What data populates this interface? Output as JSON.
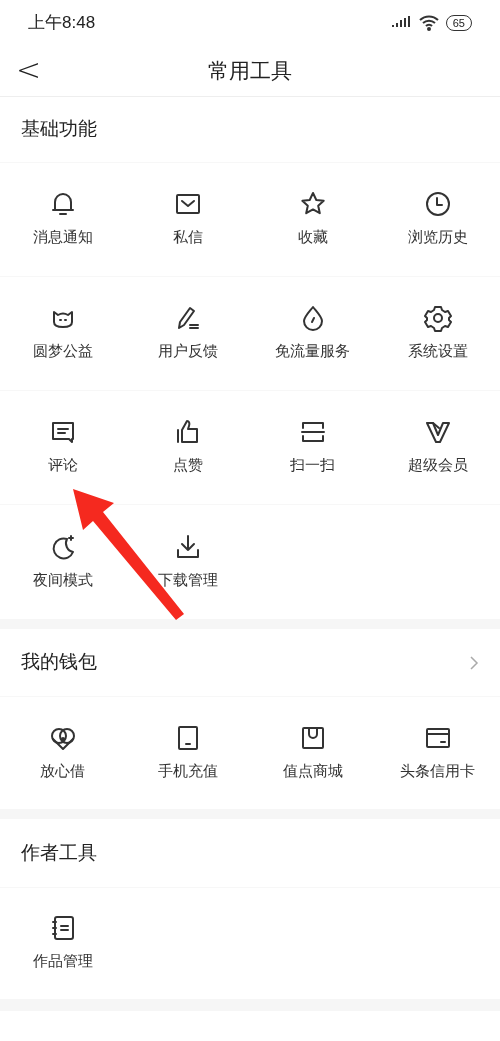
{
  "status_bar": {
    "time": "上午8:48",
    "battery": "65"
  },
  "nav": {
    "back": "<",
    "title": "常用工具"
  },
  "sections": [
    {
      "title": "基础功能",
      "has_more": false,
      "items": [
        {
          "label": "消息通知"
        },
        {
          "label": "私信"
        },
        {
          "label": "收藏"
        },
        {
          "label": "浏览历史"
        },
        {
          "label": "圆梦公益"
        },
        {
          "label": "用户反馈"
        },
        {
          "label": "免流量服务"
        },
        {
          "label": "系统设置"
        },
        {
          "label": "评论"
        },
        {
          "label": "点赞"
        },
        {
          "label": "扫一扫"
        },
        {
          "label": "超级会员"
        },
        {
          "label": "夜间模式"
        },
        {
          "label": "下载管理"
        }
      ]
    },
    {
      "title": "我的钱包",
      "has_more": true,
      "items": [
        {
          "label": "放心借"
        },
        {
          "label": "手机充值"
        },
        {
          "label": "值点商城"
        },
        {
          "label": "头条信用卡"
        }
      ]
    },
    {
      "title": "作者工具",
      "has_more": false,
      "items": [
        {
          "label": "作品管理"
        }
      ]
    }
  ]
}
